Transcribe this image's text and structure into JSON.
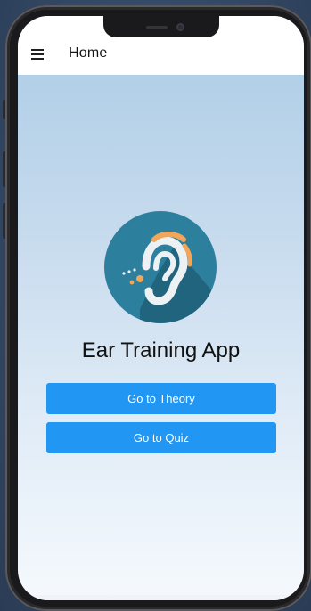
{
  "appbar": {
    "menu_icon": "hamburger-menu-icon",
    "title": "Home"
  },
  "main": {
    "logo_icon": "ear-sound-icon",
    "app_name": "Ear Training App",
    "buttons": {
      "theory_label": "Go to Theory",
      "quiz_label": "Go to Quiz"
    }
  },
  "colors": {
    "primary_button": "#2196f3",
    "logo_circle": "#2d7f9e",
    "logo_accent": "#f2a65a"
  }
}
